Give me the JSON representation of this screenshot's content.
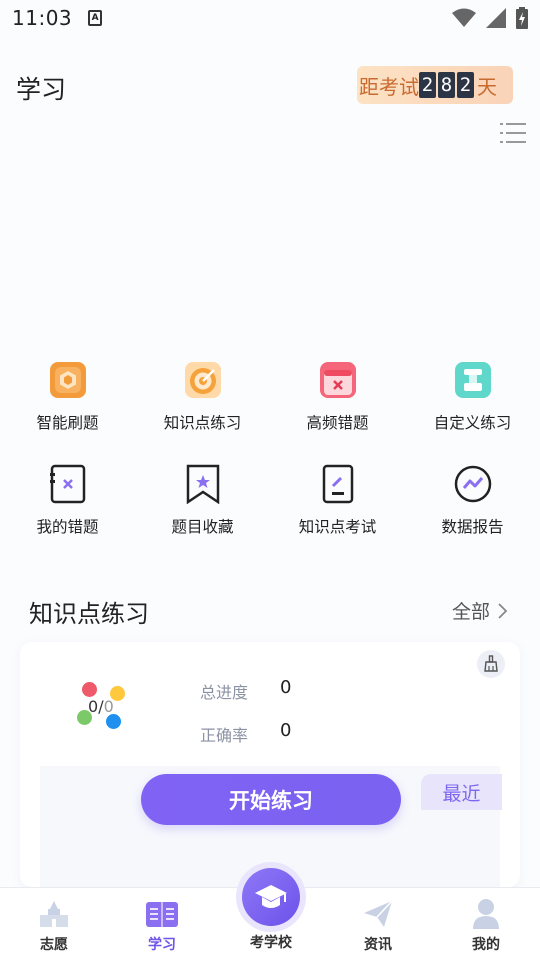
{
  "status_bar": {
    "time": "11:03",
    "notif_glyph": "A"
  },
  "header": {
    "title": "学习",
    "countdown": {
      "prefix": "距考试",
      "digits": [
        "2",
        "8",
        "2"
      ],
      "suffix": "天"
    }
  },
  "grid": [
    {
      "label": "智能刷题",
      "icon": "smart-practice-icon"
    },
    {
      "label": "知识点练习",
      "icon": "target-icon"
    },
    {
      "label": "高频错题",
      "icon": "calendar-error-icon"
    },
    {
      "label": "自定义练习",
      "icon": "custom-practice-icon"
    },
    {
      "label": "我的错题",
      "icon": "wrong-notebook-icon"
    },
    {
      "label": "题目收藏",
      "icon": "bookmark-star-icon"
    },
    {
      "label": "知识点考试",
      "icon": "exam-paper-icon"
    },
    {
      "label": "数据报告",
      "icon": "report-chart-icon"
    }
  ],
  "section": {
    "title": "知识点练习",
    "more": "全部"
  },
  "card": {
    "ratio_num": "0",
    "ratio_sep": "/",
    "ratio_den": "0",
    "progress_label": "总进度",
    "progress_value": "0",
    "accuracy_label": "正确率",
    "accuracy_value": "0",
    "start_label": "开始练习",
    "recent_label": "最近"
  },
  "tabs": [
    {
      "label": "志愿",
      "icon": "school-building-icon",
      "active": false
    },
    {
      "label": "学习",
      "icon": "open-book-icon",
      "active": true
    },
    {
      "label": "考学校",
      "icon": "graduation-cap-icon",
      "active": false
    },
    {
      "label": "资讯",
      "icon": "paper-plane-icon",
      "active": false
    },
    {
      "label": "我的",
      "icon": "user-icon",
      "active": false
    }
  ],
  "colors": {
    "accent": "#7b62f0",
    "countdown_bg": "#fde2c4",
    "countdown_text": "#c96a2f",
    "dot_red": "#ee5a6a",
    "dot_yellow": "#ffc83d",
    "dot_green": "#7cc96a",
    "dot_blue": "#1e90f0"
  }
}
